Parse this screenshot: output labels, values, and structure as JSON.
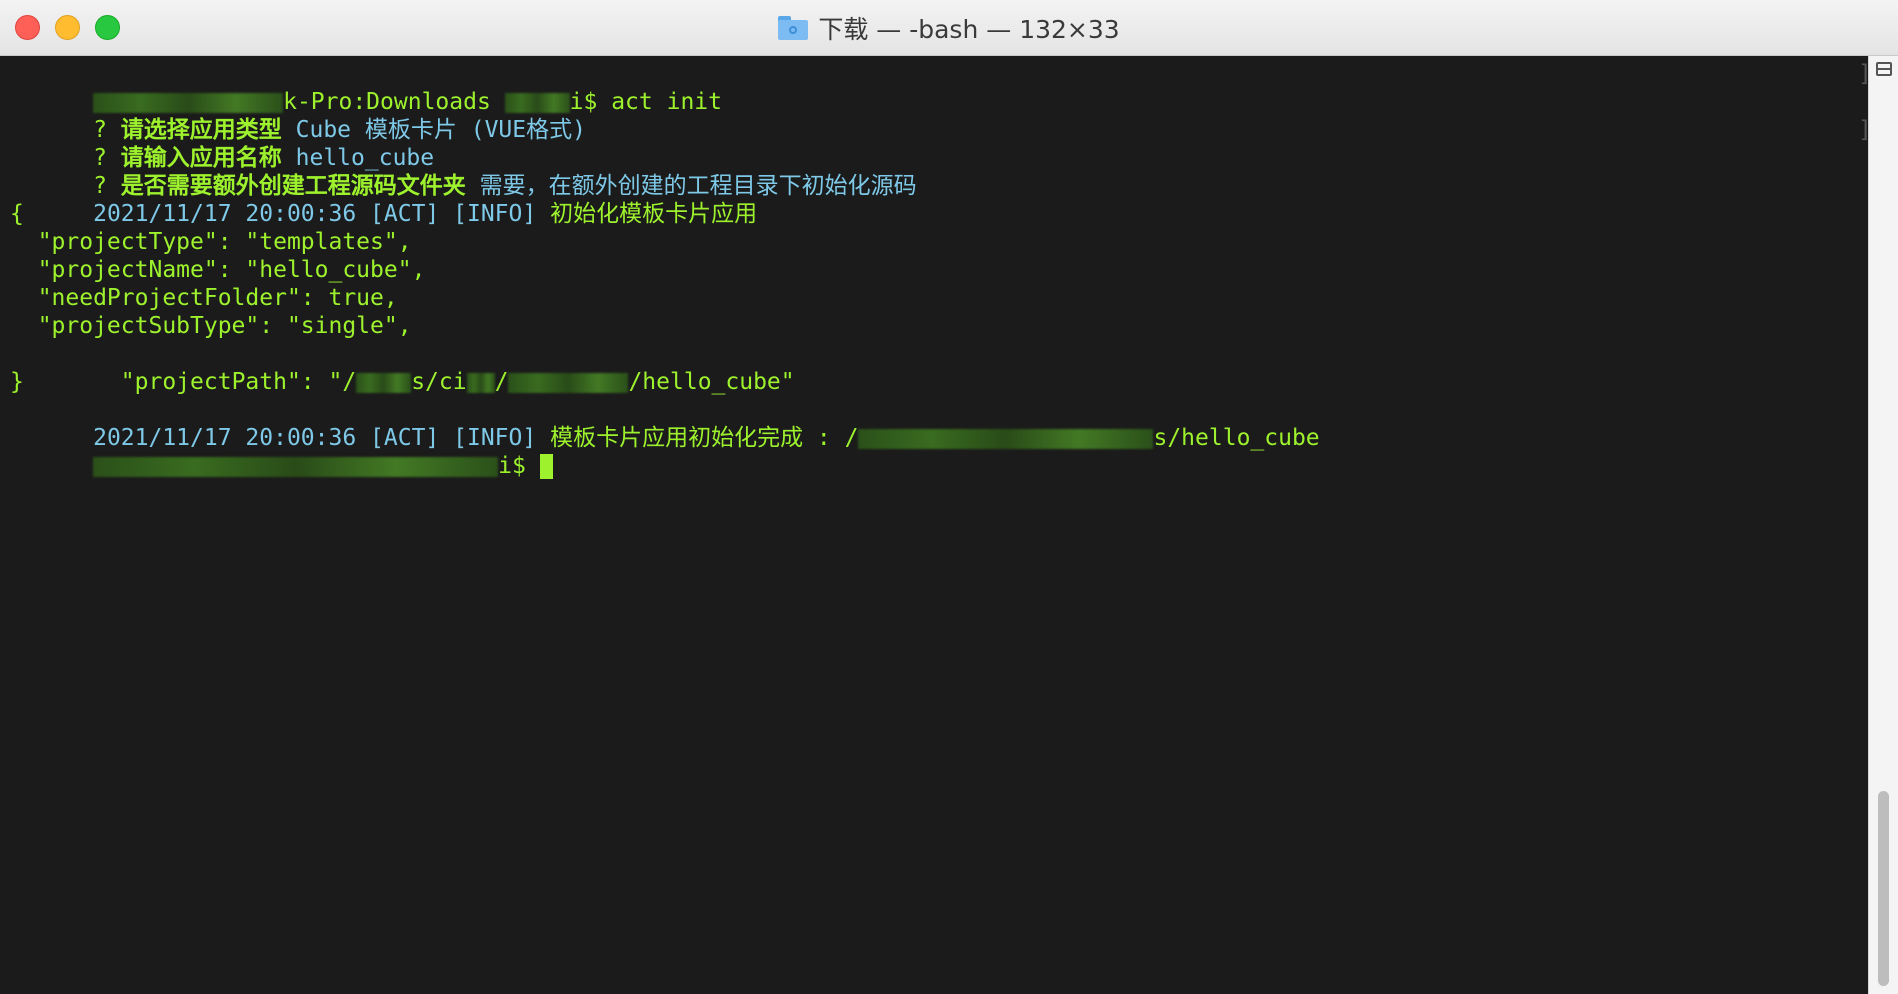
{
  "window": {
    "title": "下载 — -bash — 132×33",
    "icon": "folder-icon"
  },
  "lines": [
    {
      "prompt_suffix": "k-Pro:Downloads ",
      "prompt_end": "i$ ",
      "cmd": "act init"
    },
    {
      "mark": "? ",
      "question": "请选择应用类型",
      "answer": " Cube 模板卡片 (VUE格式)"
    },
    {
      "mark": "? ",
      "question": "请输入应用名称",
      "answer": " hello_cube"
    },
    {
      "mark": "? ",
      "question": "是否需要额外创建工程源码文件夹",
      "answer": " 需要，在额外创建的工程目录下初始化源码"
    },
    {
      "ts": "2021/11/17 20:00:36 ",
      "tag1": "[ACT]",
      "tag2": " [INFO]",
      "msg": " 初始化模板卡片应用"
    },
    {
      "text": "{"
    },
    {
      "text": "  \"projectType\": \"templates\","
    },
    {
      "text": "  \"projectName\": \"hello_cube\","
    },
    {
      "text": "  \"needProjectFolder\": true,"
    },
    {
      "text": "  \"projectSubType\": \"single\","
    },
    {
      "p1": "  \"projectPath\": \"/",
      "p2": "s/ci",
      "p3": "/",
      "p4": "/hello_cube\""
    },
    {
      "text": "}"
    },
    {
      "ts": "2021/11/17 20:00:36 ",
      "tag1": "[ACT]",
      "tag2": " [INFO]",
      "msg": " 模板卡片应用初始化完成 : /",
      "path_end": "s/hello_cube"
    },
    {
      "prompt_end": "i$ "
    }
  ],
  "colors": {
    "green": "#9df22d",
    "cyan": "#7ec9e8",
    "background": "#1b1b1b"
  }
}
